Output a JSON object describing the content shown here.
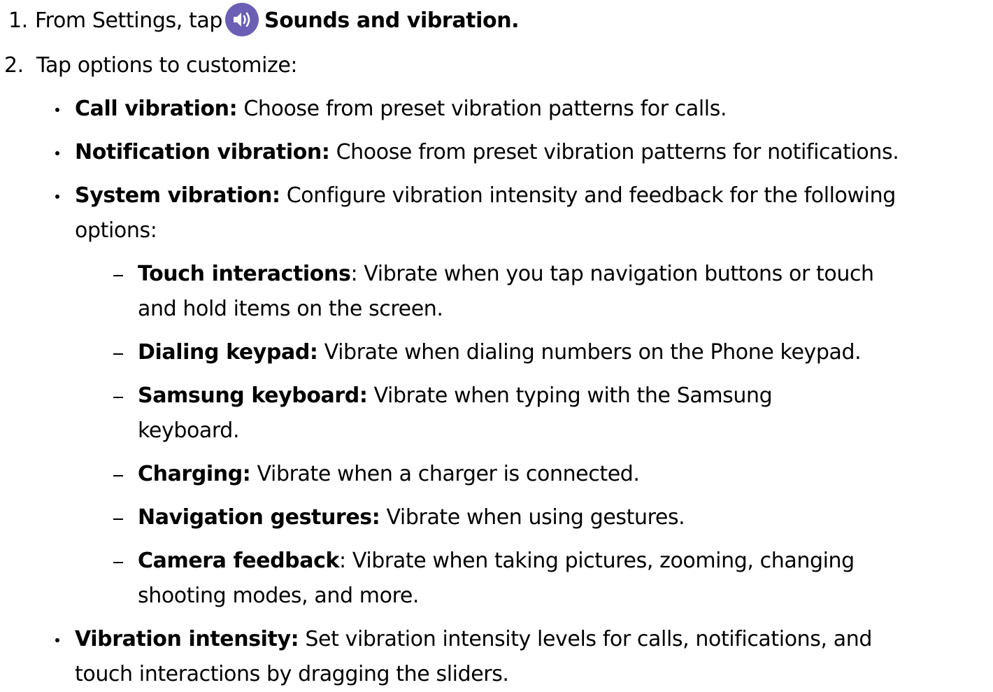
{
  "step1": {
    "number": "1.",
    "pre": "From Settings, tap",
    "icon": "speaker-icon",
    "icon_color": "#6b5fb5",
    "bold": "Sounds and vibration."
  },
  "step2": {
    "number": "2.",
    "text": "Tap options to customize:"
  },
  "items": [
    {
      "title": "Call vibration:",
      "desc": "Choose from preset vibration patterns for calls."
    },
    {
      "title": "Notification vibration:",
      "desc": "Choose from preset vibration patterns for notifications."
    },
    {
      "title": "System vibration:",
      "desc_line1": "Configure vibration intensity and feedback for the following",
      "desc_line2": "options:",
      "subitems": [
        {
          "title": "Touch interactions",
          "sep": ":",
          "desc_line1": "Vibrate when you tap navigation buttons or touch",
          "desc_line2": "and hold items on the screen."
        },
        {
          "title": "Dialing keypad:",
          "desc_line1": "Vibrate when dialing numbers on the Phone keypad."
        },
        {
          "title": "Samsung keyboard:",
          "desc_line1": "Vibrate when typing with the Samsung",
          "desc_line2": "keyboard."
        },
        {
          "title": "Charging:",
          "desc_line1": "Vibrate when a charger is connected."
        },
        {
          "title": "Navigation gestures:",
          "desc_line1": "Vibrate when using gestures."
        },
        {
          "title": "Camera feedback",
          "sep": ":",
          "desc_line1": "Vibrate when taking pictures, zooming, changing",
          "desc_line2": "shooting modes, and more."
        }
      ]
    },
    {
      "title": "Vibration intensity:",
      "desc_line1": "Set vibration intensity levels for calls, notifications, and",
      "desc_line2": "touch interactions by dragging the sliders."
    }
  ]
}
